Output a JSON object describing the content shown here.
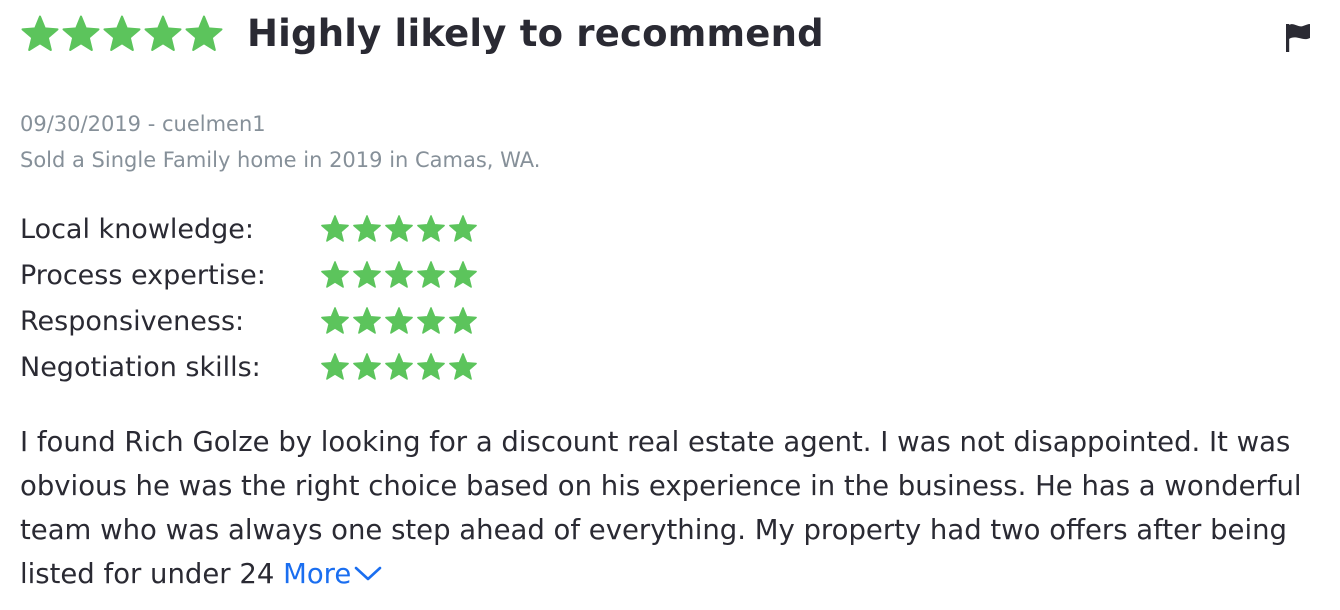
{
  "review": {
    "rating": 5,
    "title": "Highly likely to recommend",
    "date_user": "09/30/2019 - cuelmen1",
    "transaction": "Sold a Single Family home in 2019 in Camas, WA.",
    "flag_icon": "flag-icon",
    "star_color": "#5cc45c",
    "sub_ratings": [
      {
        "label": "Local knowledge:",
        "rating": 5
      },
      {
        "label": "Process expertise:",
        "rating": 5
      },
      {
        "label": "Responsiveness:",
        "rating": 5
      },
      {
        "label": "Negotiation skills:",
        "rating": 5
      }
    ],
    "text": "I found Rich Golze by looking for a discount real estate agent. I was not disappointed.  It was obvious he was the right choice based on his experience in the business.  He has a wonderful team who was always one step ahead of everything.  My property had two offers after being listed for under 24",
    "more_label": "More",
    "link_color": "#1a6ef0"
  }
}
